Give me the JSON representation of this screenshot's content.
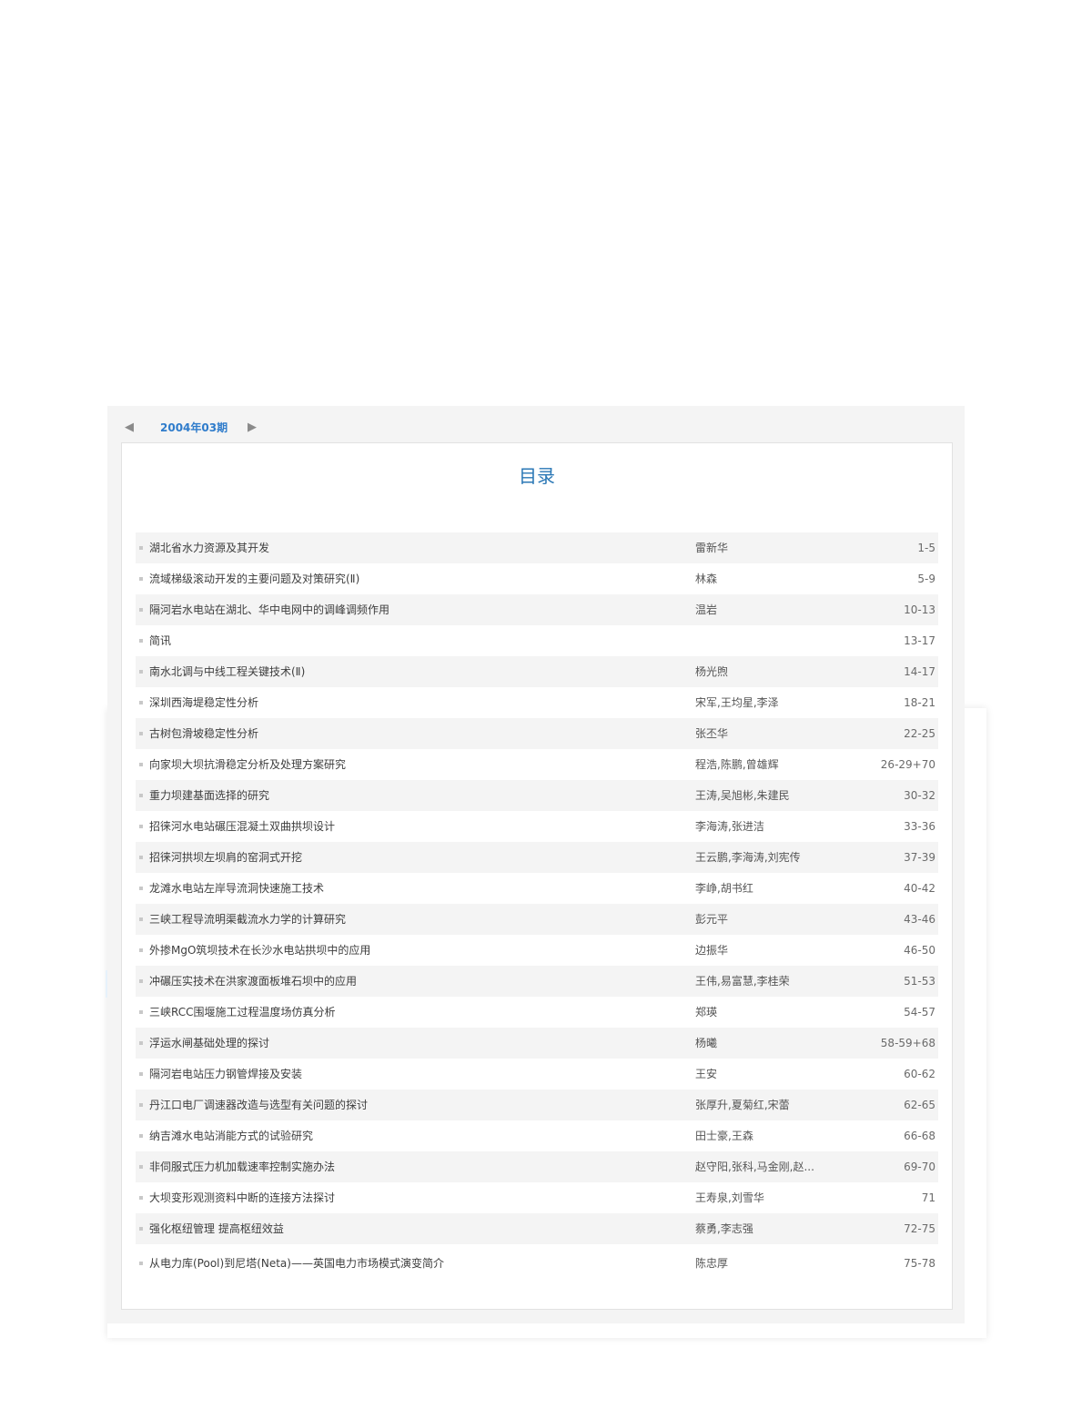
{
  "issue": {
    "label": "2004年03期",
    "prev_arrow": "◀",
    "next_arrow": "▶"
  },
  "toc": {
    "title": "目录",
    "items": [
      {
        "title": "湖北省水力资源及其开发",
        "author": "雷新华",
        "pages": "1-5"
      },
      {
        "title": "流域梯级滚动开发的主要问题及对策研究(Ⅱ)",
        "author": "林森",
        "pages": "5-9"
      },
      {
        "title": "隔河岩水电站在湖北、华中电网中的调峰调频作用",
        "author": "温岩",
        "pages": "10-13"
      },
      {
        "title": "简讯",
        "author": "",
        "pages": "13-17"
      },
      {
        "title": "南水北调与中线工程关键技术(Ⅱ)",
        "author": "杨光煦",
        "pages": "14-17"
      },
      {
        "title": "深圳西海堤稳定性分析",
        "author": "宋军,王均星,李泽",
        "pages": "18-21"
      },
      {
        "title": "古树包滑坡稳定性分析",
        "author": "张丕华",
        "pages": "22-25"
      },
      {
        "title": "向家坝大坝抗滑稳定分析及处理方案研究",
        "author": "程浩,陈鹏,曾雄辉",
        "pages": "26-29+70"
      },
      {
        "title": "重力坝建基面选择的研究",
        "author": "王涛,吴旭彬,朱建民",
        "pages": "30-32"
      },
      {
        "title": "招徕河水电站碾压混凝土双曲拱坝设计",
        "author": "李海涛,张进洁",
        "pages": "33-36"
      },
      {
        "title": "招徕河拱坝左坝肩的窑洞式开挖",
        "author": "王云鹏,李海涛,刘宪传",
        "pages": "37-39"
      },
      {
        "title": "龙滩水电站左岸导流洞快速施工技术",
        "author": "李峥,胡书红",
        "pages": "40-42"
      },
      {
        "title": "三峡工程导流明渠截流水力学的计算研究",
        "author": "彭元平",
        "pages": "43-46"
      },
      {
        "title": "外掺MgO筑坝技术在长沙水电站拱坝中的应用",
        "author": "边振华",
        "pages": "46-50"
      },
      {
        "title": "冲碾压实技术在洪家渡面板堆石坝中的应用",
        "author": "王伟,易富慧,李桂荣",
        "pages": "51-53"
      },
      {
        "title": "三峡RCC围堰施工过程温度场仿真分析",
        "author": "郑瑛",
        "pages": "54-57"
      },
      {
        "title": "浮运水闸基础处理的探讨",
        "author": "杨曦",
        "pages": "58-59+68"
      },
      {
        "title": "隔河岩电站压力钢管焊接及安装",
        "author": "王安",
        "pages": "60-62"
      },
      {
        "title": "丹江口电厂调速器改造与选型有关问题的探讨",
        "author": "张厚升,夏菊红,宋蕾",
        "pages": "62-65"
      },
      {
        "title": "纳吉滩水电站消能方式的试验研究",
        "author": "田士豪,王森",
        "pages": "66-68"
      },
      {
        "title": "非伺服式压力机加载速率控制实施办法",
        "author": "赵守阳,张科,马金刚,赵...",
        "pages": "69-70"
      },
      {
        "title": "大坝变形观测资料中断的连接方法探讨",
        "author": "王寿泉,刘雪华",
        "pages": "71"
      },
      {
        "title": "强化枢纽管理 提高枢纽效益",
        "author": "蔡勇,李志强",
        "pages": "72-75"
      },
      {
        "title": "从电力库(Pool)到尼塔(Neta)——英国电力市场模式演变简介",
        "author": "陈忠厚",
        "pages": "75-78"
      }
    ]
  }
}
